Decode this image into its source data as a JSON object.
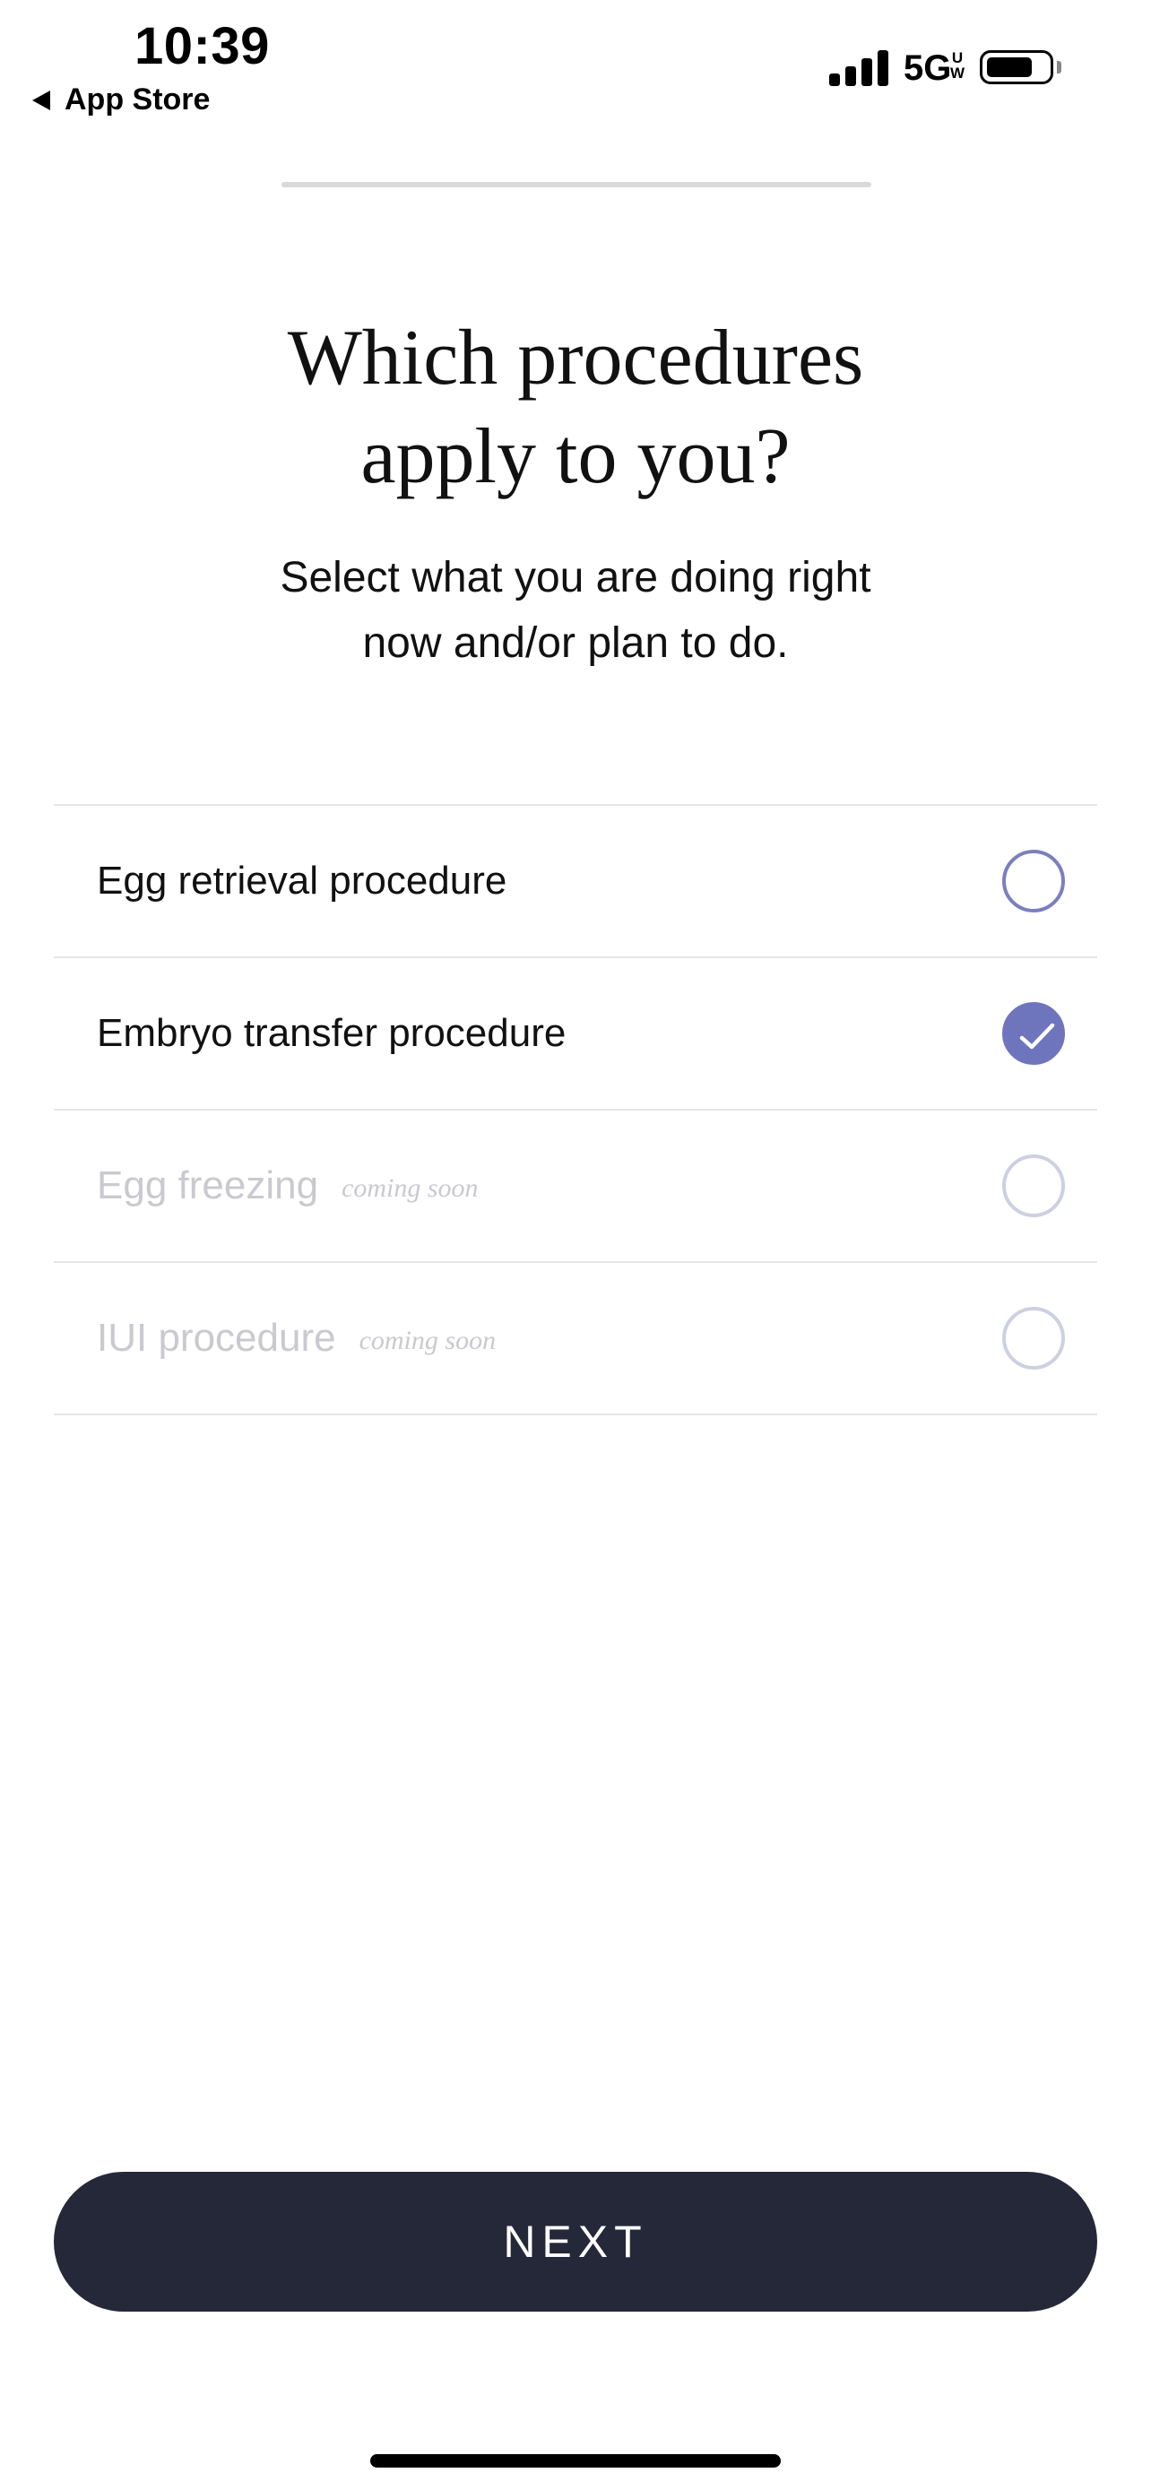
{
  "status_bar": {
    "time": "10:39",
    "back_app_label": "App Store",
    "network": "5G",
    "network_superscript": "UW",
    "battery_level": 0.75
  },
  "progress": {
    "value": 1.0
  },
  "header": {
    "title": "Which procedures\napply to you?",
    "subtitle": "Select what you are doing right\nnow and/or plan to do."
  },
  "options": [
    {
      "label": "Egg retrieval procedure",
      "note": "",
      "checked": false,
      "disabled": false
    },
    {
      "label": "Embryo transfer procedure",
      "note": "",
      "checked": true,
      "disabled": false
    },
    {
      "label": "Egg freezing",
      "note": "coming soon",
      "checked": false,
      "disabled": true
    },
    {
      "label": "IUI procedure",
      "note": "coming soon",
      "checked": false,
      "disabled": true
    }
  ],
  "footer": {
    "next_label": "NEXT"
  },
  "colors": {
    "accent": "#6f75bd",
    "button": "#252838",
    "disabled_text": "#c9c9cf",
    "divider": "#e6e6e6"
  },
  "icons": {
    "back": "triangle-left-icon",
    "signal": "cellular-signal-icon",
    "battery": "battery-icon",
    "checked": "checkmark-icon"
  }
}
